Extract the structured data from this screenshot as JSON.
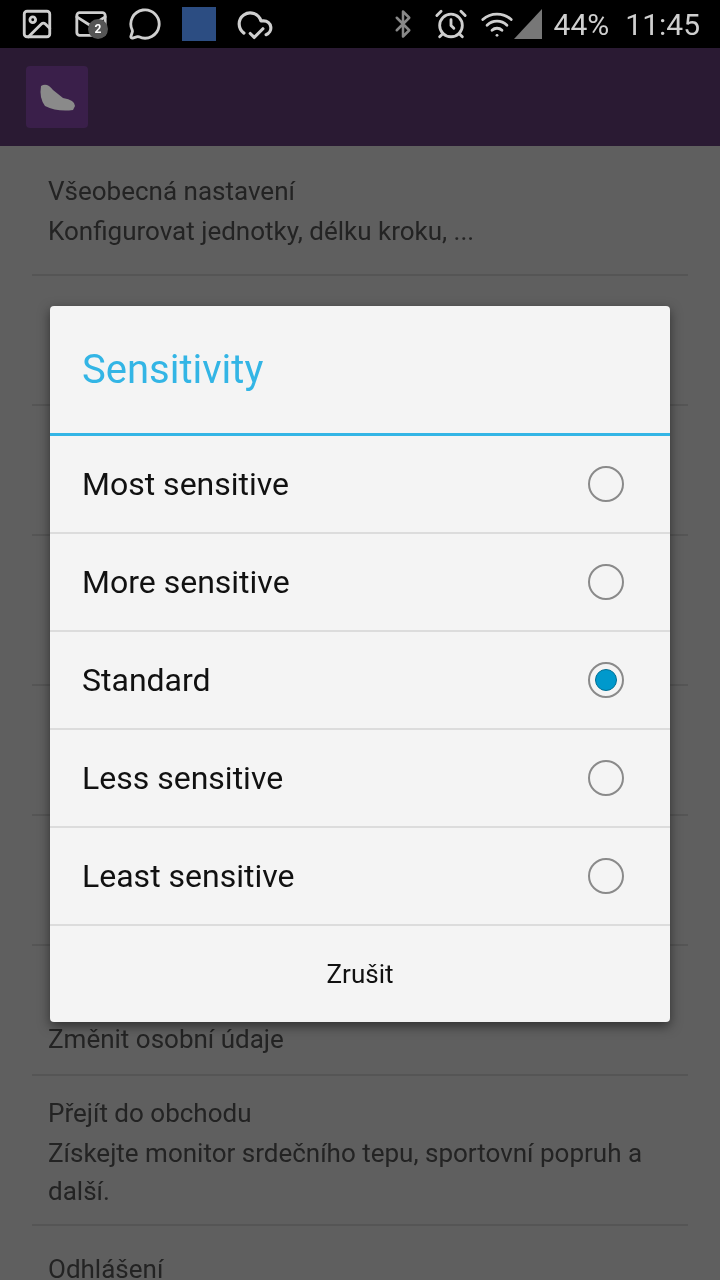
{
  "status_bar": {
    "notification_badge": "2",
    "battery": "44%",
    "time": "11:45"
  },
  "settings": [
    {
      "title": "Všeobecná nastavení",
      "subtitle": "Konfigurovat jednotky, délku kroku, ..."
    },
    {
      "title": "Změnit osobní údaje"
    },
    {
      "title": "Přejít do obchodu",
      "subtitle": "Získejte monitor srdečního tepu, sportovní popruh a další."
    },
    {
      "title": "Odhlášení"
    }
  ],
  "dialog": {
    "title": "Sensitivity",
    "options": [
      {
        "label": "Most sensitive",
        "selected": false
      },
      {
        "label": "More sensitive",
        "selected": false
      },
      {
        "label": "Standard",
        "selected": true
      },
      {
        "label": "Less sensitive",
        "selected": false
      },
      {
        "label": "Least sensitive",
        "selected": false
      }
    ],
    "cancel": "Zrušit"
  }
}
